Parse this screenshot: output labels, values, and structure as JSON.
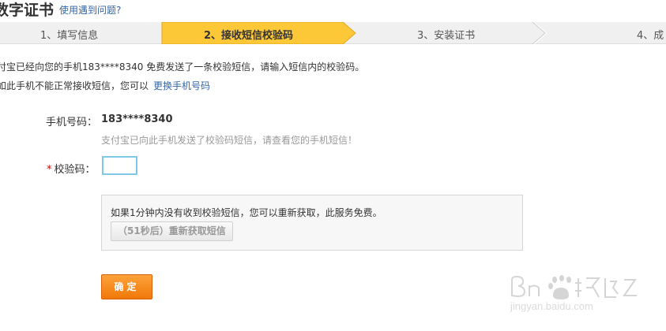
{
  "header": {
    "title": "数字证书",
    "help_link": "使用遇到问题?"
  },
  "steps": [
    {
      "label": "1、填写信息"
    },
    {
      "label": "2、接收短信校验码",
      "active": true
    },
    {
      "label": "3、安装证书"
    },
    {
      "label": "4、成"
    }
  ],
  "info": {
    "line1": "付宝已经向您的手机183****8340 免费发送了一条校验短信，请输入短信内的校验码。",
    "line2": "如此手机不能正常接收短信，您可以",
    "change_phone_link": "更换手机号码"
  },
  "form": {
    "phone_label": "手机号码：",
    "phone_value": "183****8340",
    "phone_hint": "支付宝已向此手机发送了校验码短信，请查看您的手机短信！",
    "required_mark": "*",
    "code_label": "校验码：",
    "code_value": ""
  },
  "resend": {
    "text": "如果1分钟内没有收到校验短信，您可以重新获取，此服务免费。",
    "button_label": "（51秒后）重新获取短信"
  },
  "confirm_label": "确定",
  "watermark": {
    "logo_text": "Bai du 经验",
    "url": "jingyan.baidu.com"
  },
  "colors": {
    "accent_link": "#3366aa",
    "active_step": "#fcc838",
    "confirm_button": "#f1780a",
    "input_border": "#7ec8e8"
  }
}
